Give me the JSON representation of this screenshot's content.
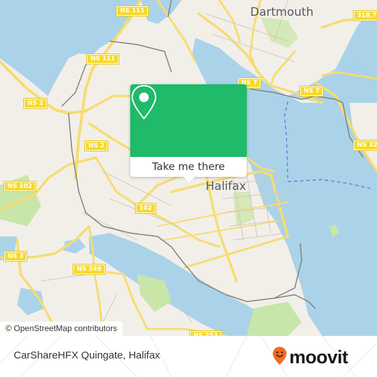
{
  "map": {
    "colors": {
      "water": "#aad3e9",
      "land": "#f2efe9",
      "park": "#c8e6a8",
      "road": "#f7dc6f",
      "rail": "#777777",
      "ferry": "#5577dd"
    },
    "cities": [
      {
        "name": "Dartmouth"
      },
      {
        "name": "Halifax"
      }
    ],
    "shields": [
      {
        "label": "NS 111"
      },
      {
        "label": "NS 111"
      },
      {
        "label": "NS 2"
      },
      {
        "label": "NS  2"
      },
      {
        "label": "NS 7"
      },
      {
        "label": "NS 7"
      },
      {
        "label": "318,7"
      },
      {
        "label": "NS 32"
      },
      {
        "label": "NS 102"
      },
      {
        "label": "102"
      },
      {
        "label": "NS 3"
      },
      {
        "label": "NS 349"
      },
      {
        "label": "NS 253"
      }
    ],
    "attribution": "© OpenStreetMap contributors"
  },
  "popup": {
    "icon": "location-pin-icon",
    "accent": "#1fba6a",
    "button_label": "Take me there"
  },
  "footer": {
    "title": "CarShareHFX Quingate, Halifax",
    "logo_text": "moovit",
    "logo_color": "#f26b21"
  }
}
